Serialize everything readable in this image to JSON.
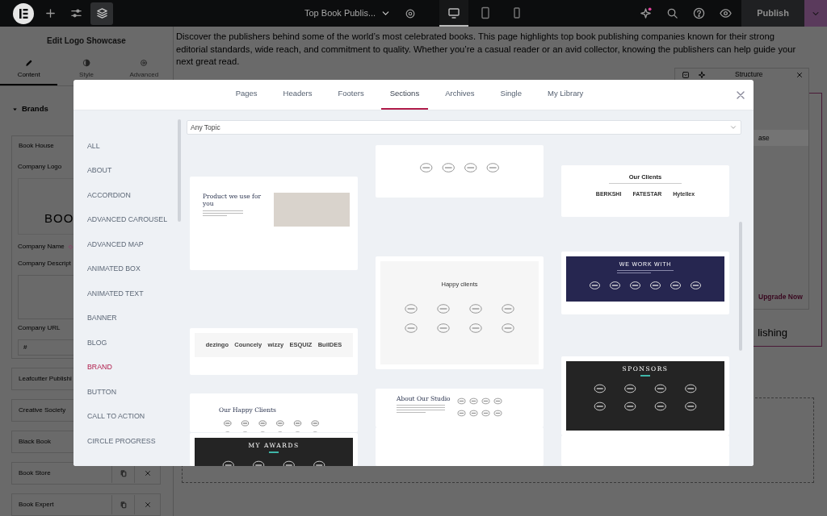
{
  "topbar": {
    "title": "Top Book Publis...",
    "publish_label": "Publish",
    "tools": [
      {
        "kind": "add",
        "selected": false
      },
      {
        "kind": "settings",
        "selected": false
      },
      {
        "kind": "layers",
        "selected": true
      }
    ],
    "devices": [
      {
        "kind": "desktop",
        "selected": true
      },
      {
        "kind": "tablet",
        "selected": false
      },
      {
        "kind": "mobile",
        "selected": false
      }
    ]
  },
  "panel": {
    "title": "Edit Logo Showcase",
    "tabs": [
      {
        "kind": "content",
        "label": "Content",
        "selected": true
      },
      {
        "kind": "style",
        "label": "Style",
        "selected": false
      },
      {
        "kind": "advanced",
        "label": "Advanced",
        "selected": false
      }
    ],
    "section": {
      "label": "Brands",
      "expanded": true
    },
    "items": [
      {
        "label": "Book House",
        "expanded": true,
        "fields": [
          {
            "kind": "image",
            "label": "Company Logo",
            "value": "BOO"
          },
          {
            "kind": "dynamic",
            "label": "Company Name"
          },
          {
            "kind": "textarea",
            "label": "Company Descript"
          },
          {
            "kind": "input",
            "label": "Company URL",
            "value": "#"
          }
        ]
      },
      {
        "label": "Leafcutter Publishi",
        "expanded": false
      },
      {
        "label": "Creative Society",
        "expanded": false
      },
      {
        "label": "Black Book",
        "expanded": false
      },
      {
        "label": "Book Store",
        "expanded": false
      },
      {
        "label": "Book Expert",
        "expanded": false
      }
    ]
  },
  "canvas": {
    "intro": "Discover the publishers behind some of the world’s most celebrated books. This page highlights top book publishing companies known for their strong editorial standards, wide reach, and commitment to quality. Whether you’re a casual reader or an avid collector, knowing the publishers can help guide your next great read.",
    "structure": {
      "title": "Structure",
      "selected_item": "ase",
      "upgrade_link": "Upgrade Now"
    },
    "heading_fragment": "lishing"
  },
  "library": {
    "tabs": [
      {
        "label": "Pages",
        "selected": false
      },
      {
        "label": "Headers",
        "selected": false
      },
      {
        "label": "Footers",
        "selected": false
      },
      {
        "label": "Sections",
        "selected": true
      },
      {
        "label": "Archives",
        "selected": false
      },
      {
        "label": "Single",
        "selected": false
      },
      {
        "label": "My Library",
        "selected": false
      }
    ],
    "categories": [
      {
        "label": "ALL",
        "selected": false
      },
      {
        "label": "ABOUT",
        "selected": false
      },
      {
        "label": "ACCORDION",
        "selected": false
      },
      {
        "label": "ADVANCED CAROUSEL",
        "selected": false
      },
      {
        "label": "ADVANCED MAP",
        "selected": false
      },
      {
        "label": "ANIMATED BOX",
        "selected": false
      },
      {
        "label": "ANIMATED TEXT",
        "selected": false
      },
      {
        "label": "BANNER",
        "selected": false
      },
      {
        "label": "BLOG",
        "selected": false
      },
      {
        "label": "BRAND",
        "selected": true
      },
      {
        "label": "BUTTON",
        "selected": false
      },
      {
        "label": "CALL TO ACTION",
        "selected": false
      },
      {
        "label": "CIRCLE PROGRESS",
        "selected": false
      }
    ],
    "topic_filter": {
      "value": "Any Topic"
    },
    "columns": [
      [
        {
          "kind": "product",
          "heading": "Product we use for you"
        },
        {
          "kind": "logo-strip",
          "logos": [
            "dezingo",
            "Councely",
            "wizzy",
            "ESQUIZ",
            "BuilDES"
          ]
        },
        {
          "kind": "emblem-grid",
          "heading": "Our Happy Clients"
        },
        {
          "kind": "dark-title",
          "heading": "MY AWARDS"
        }
      ],
      [
        {
          "kind": "emblem-row"
        },
        {
          "kind": "emblem-panel",
          "heading": "Happy clients"
        },
        {
          "kind": "studio",
          "heading": "About Our Studio"
        },
        {
          "kind": "blank"
        }
      ],
      [
        {
          "kind": "client-logos",
          "heading": "Our Clients",
          "logos": [
            "BERKSHI",
            "FATESTAR",
            "Hytellex"
          ]
        },
        {
          "kind": "navy",
          "heading": "WE WORK WITH"
        },
        {
          "kind": "dark-title",
          "heading": "SPONSORS"
        },
        {
          "kind": "blank"
        }
      ]
    ]
  }
}
